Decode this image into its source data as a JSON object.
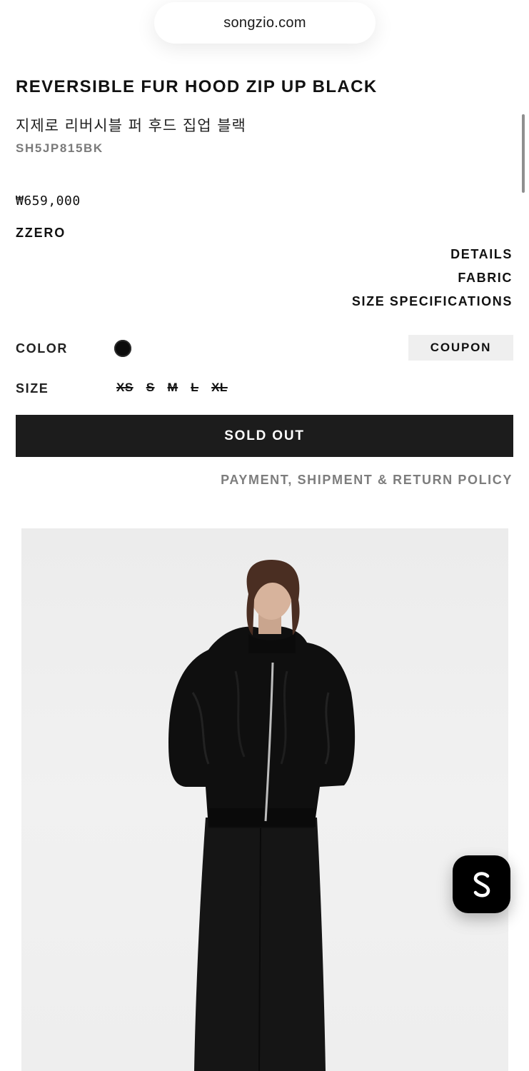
{
  "browser": {
    "url": "songzio.com"
  },
  "product": {
    "title_en": "REVERSIBLE FUR HOOD ZIP UP BLACK",
    "title_ko": "지제로 리버시블 퍼 후드 집업 블랙",
    "sku": "SH5JP815BK",
    "price": "₩659,000",
    "brand": "ZZERO"
  },
  "info_links": [
    "DETAILS",
    "FABRIC",
    "SIZE SPECIFICATIONS"
  ],
  "options": {
    "color_label": "COLOR",
    "color_swatch": "#0c0c0c",
    "size_label": "SIZE",
    "sizes": [
      "XS",
      "S",
      "M",
      "L",
      "XL"
    ],
    "sizes_available": false
  },
  "coupon_label": "COUPON",
  "sold_out_label": "SOLD OUT",
  "policy_label": "PAYMENT, SHIPMENT & RETURN POLICY",
  "chat_icon": "s-logo-icon",
  "colors": {
    "accent": "#1c1c1c",
    "muted": "#7d7d7d",
    "coupon_bg": "#efefef"
  }
}
